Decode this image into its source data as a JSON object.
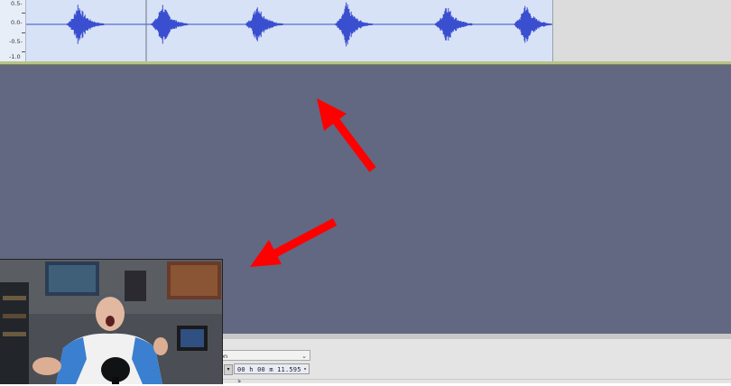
{
  "track": {
    "scale_labels": [
      "0.5-",
      "0.0-",
      "-0.5-",
      "-1.0"
    ],
    "waveform_color": "#3a4ed0",
    "bursts": [
      0.09,
      0.25,
      0.43,
      0.6,
      0.79,
      0.94
    ]
  },
  "annotations": {
    "arrow_color": "#ff0000",
    "arrows": [
      "arrow-up-left",
      "arrow-down-left"
    ]
  },
  "toolbar": {
    "snap_value": "on",
    "time_value": "00 h 00 m 11.595 s",
    "time_prefix_glyph": "▾",
    "chevron_glyph": "⌄"
  },
  "webcam": {
    "description_icon": "presenter-webcam"
  },
  "colors": {
    "workspace": "#626782",
    "track_bg": "#d7e2f6",
    "toolbar_bg": "#e4e4e4"
  }
}
